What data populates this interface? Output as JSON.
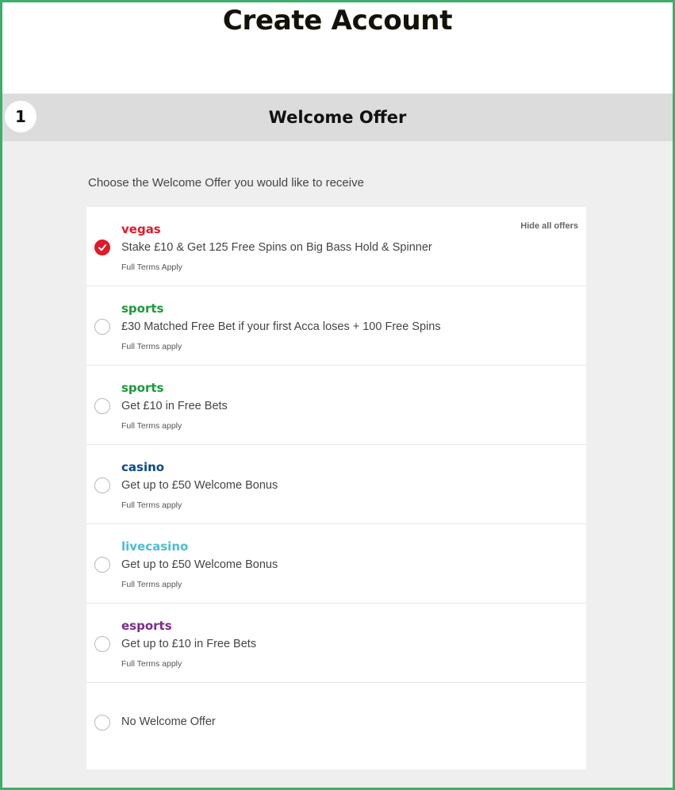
{
  "page": {
    "title": "Create Account"
  },
  "step": {
    "number": "1",
    "title": "Welcome Offer"
  },
  "intro": "Choose the Welcome Offer you would like to receive",
  "hide_all_offers": "Hide all offers",
  "colors": {
    "vegas": "#e01a2a",
    "sports": "#1a9a3a",
    "casino": "#0b4a8a",
    "livecasino": "#4dbcd8",
    "esports": "#7b2c8c",
    "frame": "#3dae6b"
  },
  "offers": [
    {
      "brand": "vegas",
      "description": "Stake £10 & Get 125 Free Spins on Big Bass Hold & Spinner",
      "terms": "Full Terms Apply",
      "selected": true
    },
    {
      "brand": "sports",
      "description": "£30 Matched Free Bet if your first Acca loses + 100 Free Spins",
      "terms": "Full Terms apply",
      "selected": false
    },
    {
      "brand": "sports",
      "description": "Get £10 in Free Bets",
      "terms": "Full Terms apply",
      "selected": false
    },
    {
      "brand": "casino",
      "description": "Get up to £50 Welcome Bonus",
      "terms": "Full Terms apply",
      "selected": false
    },
    {
      "brand": "livecasino",
      "description": "Get up to £50 Welcome Bonus",
      "terms": "Full Terms apply",
      "selected": false
    },
    {
      "brand": "esports",
      "description": "Get up to £10 in Free Bets",
      "terms": "Full Terms apply",
      "selected": false
    }
  ],
  "no_offer": {
    "label": "No Welcome Offer",
    "selected": false
  }
}
